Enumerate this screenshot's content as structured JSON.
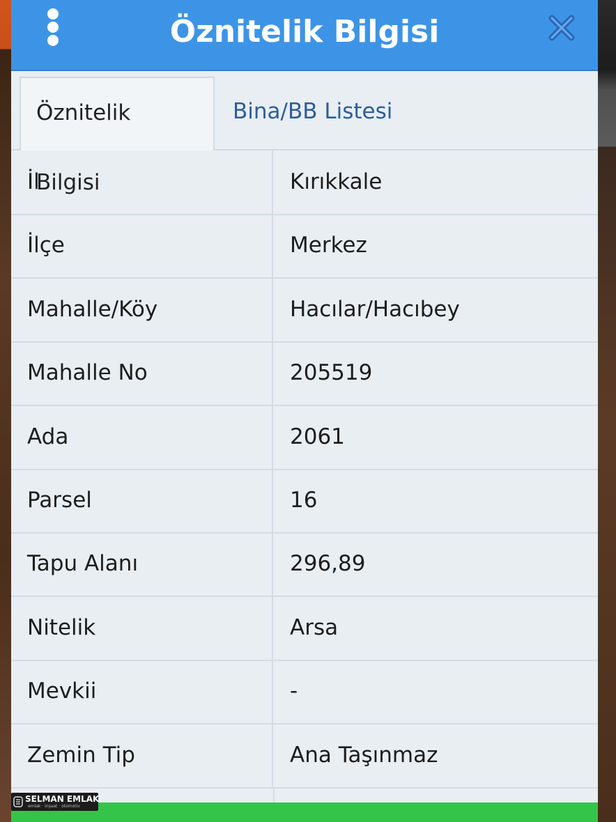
{
  "header": {
    "title": "Öznitelik Bilgisi"
  },
  "tabs": [
    {
      "label": "Öznitelik Bilgisi",
      "active": true
    },
    {
      "label": "Bina/BB Listesi",
      "active": false
    }
  ],
  "rows": [
    {
      "key": "İl",
      "value": "Kırıkkale"
    },
    {
      "key": "İlçe",
      "value": "Merkez"
    },
    {
      "key": "Mahalle/Köy",
      "value": "Hacılar/Hacıbey"
    },
    {
      "key": "Mahalle No",
      "value": "205519"
    },
    {
      "key": "Ada",
      "value": "2061"
    },
    {
      "key": "Parsel",
      "value": "16"
    },
    {
      "key": "Tapu Alanı",
      "value": "296,89"
    },
    {
      "key": "Nitelik",
      "value": "Arsa"
    },
    {
      "key": "Mevkii",
      "value": "-"
    },
    {
      "key": "Zemin Tip",
      "value": "Ana Taşınmaz"
    }
  ],
  "logo": {
    "brand": "SELMAN EMLAK",
    "tagline": "emlak · inşaat · otomotiv"
  },
  "colors": {
    "header": "#3d94e6",
    "tab_link": "#2e5d99",
    "footer_bar": "#35c44a"
  },
  "icons": {
    "menu": "vertical-dots-icon",
    "close": "close-icon"
  }
}
